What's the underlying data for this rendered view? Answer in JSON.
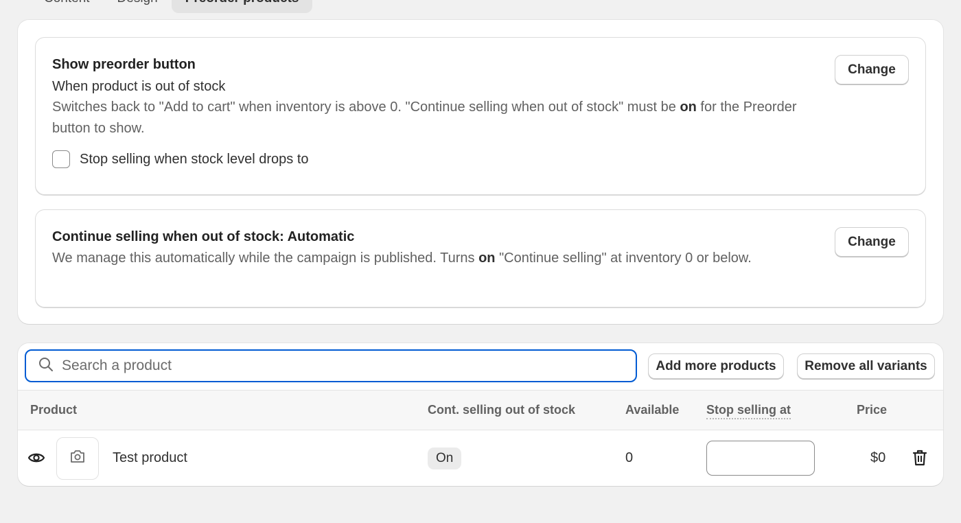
{
  "tabs": [
    {
      "label": "Content"
    },
    {
      "label": "Design"
    },
    {
      "label": "Preorder products",
      "active": true
    }
  ],
  "preorder_button": {
    "title": "Show preorder button",
    "subtitle": "When product is out of stock",
    "desc_before": "Switches back to \"Add to cart\" when inventory is above 0. \"Continue selling when out of stock\" must be ",
    "desc_bold": "on",
    "desc_after": " for the Preorder button to show.",
    "change_label": "Change",
    "checkbox_label": "Stop selling when stock level drops to",
    "checkbox_checked": false
  },
  "continue_selling": {
    "title": "Continue selling when out of stock: Automatic",
    "desc_before": "We manage this automatically while the campaign is published. Turns ",
    "desc_bold": "on",
    "desc_after": " \"Continue selling\" at inventory 0 or below.",
    "change_label": "Change"
  },
  "products": {
    "search_placeholder": "Search a product",
    "search_value": "",
    "add_label": "Add more products",
    "remove_label": "Remove all variants",
    "columns": {
      "product": "Product",
      "cont": "Cont. selling out of stock",
      "available": "Available",
      "stop": "Stop selling at",
      "price": "Price"
    },
    "rows": [
      {
        "name": "Test product",
        "cont": "On",
        "available": "0",
        "stop_value": "",
        "price": "$0"
      }
    ]
  },
  "colors": {
    "focus": "#005bd3",
    "background": "#f1f1f1"
  },
  "icons": [
    "search-icon",
    "eye-icon",
    "camera-icon",
    "trash-icon"
  ]
}
